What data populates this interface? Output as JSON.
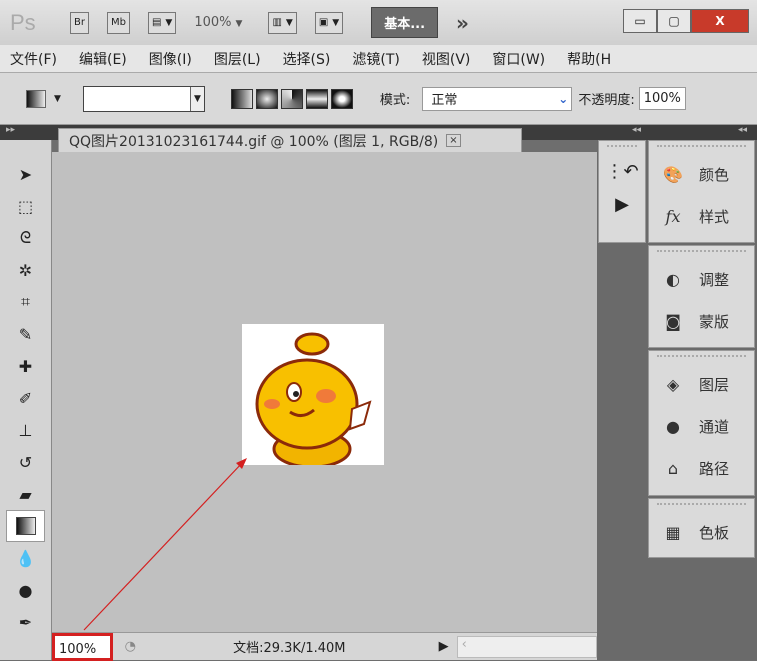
{
  "titlebar": {
    "logo": "Ps",
    "bridge": "Br",
    "minibridge": "Mb",
    "zoom": "100%",
    "workspace": "基本...",
    "more": "»",
    "minimize": "▭",
    "restore": "▢",
    "close": "X"
  },
  "menu": [
    "文件(F)",
    "编辑(E)",
    "图像(I)",
    "图层(L)",
    "选择(S)",
    "滤镜(T)",
    "视图(V)",
    "窗口(W)",
    "帮助(H"
  ],
  "options": {
    "mode_label": "模式:",
    "mode_value": "正常",
    "opacity_label": "不透明度:",
    "opacity_value": "100%"
  },
  "document": {
    "tab_title": "QQ图片20131023161744.gif @ 100% (图层 1, RGB/8)",
    "close": "×"
  },
  "status": {
    "zoom": "100%",
    "doc_info": "文档:29.3K/1.40M"
  },
  "panels": [
    {
      "items": [
        {
          "icon": "palette-icon",
          "glyph": "🎨",
          "label": "颜色"
        },
        {
          "icon": "fx-icon",
          "glyph": "fx",
          "label": "样式"
        }
      ]
    },
    {
      "items": [
        {
          "icon": "adjust-icon",
          "glyph": "◐",
          "label": "调整"
        },
        {
          "icon": "mask-icon",
          "glyph": "◙",
          "label": "蒙版"
        }
      ]
    },
    {
      "items": [
        {
          "icon": "layers-icon",
          "glyph": "◈",
          "label": "图层"
        },
        {
          "icon": "channels-icon",
          "glyph": "●",
          "label": "通道"
        },
        {
          "icon": "paths-icon",
          "glyph": "⌂",
          "label": "路径"
        }
      ]
    },
    {
      "items": [
        {
          "icon": "swatches-icon",
          "glyph": "▦",
          "label": "色板"
        }
      ]
    }
  ],
  "annotation_color": "#d42020"
}
